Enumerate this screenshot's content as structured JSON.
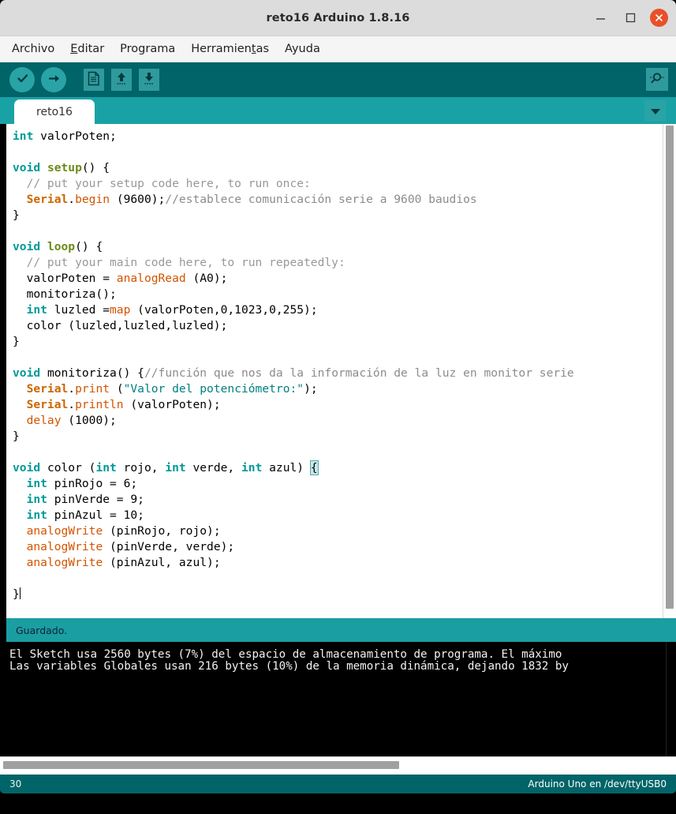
{
  "window": {
    "title": "reto16 Arduino 1.8.16",
    "minimize_label": "minimize-icon",
    "maximize_label": "maximize-icon",
    "close_label": "close-icon"
  },
  "menu": {
    "items": [
      {
        "label": "Archivo",
        "mnemonic": ""
      },
      {
        "label": "Editar",
        "mnemonic": "E"
      },
      {
        "label": "Programa",
        "mnemonic": ""
      },
      {
        "label": "Herramientas",
        "mnemonic": "t"
      },
      {
        "label": "Ayuda",
        "mnemonic": ""
      }
    ]
  },
  "toolbar": {
    "buttons": [
      {
        "name": "verify-button",
        "icon": "check-icon",
        "tooltip": "Verificar"
      },
      {
        "name": "upload-button",
        "icon": "arrow-right-icon",
        "tooltip": "Subir"
      },
      {
        "name": "new-button",
        "icon": "new-file-icon",
        "tooltip": "Nuevo"
      },
      {
        "name": "open-button",
        "icon": "arrow-up-icon",
        "tooltip": "Abrir"
      },
      {
        "name": "save-button",
        "icon": "arrow-down-icon",
        "tooltip": "Guardar"
      }
    ],
    "serial_monitor": {
      "name": "serial-monitor-button",
      "icon": "magnifier-icon"
    }
  },
  "tabs": {
    "active": "reto16",
    "items": [
      "reto16"
    ],
    "menu_icon": "chevron-down-icon"
  },
  "editor": {
    "lines": [
      "int valorPoten;",
      "",
      "void setup() {",
      "  // put your setup code here, to run once:",
      "  Serial.begin (9600);//establece comunicación serie a 9600 baudios",
      "}",
      "",
      "void loop() {",
      "  // put your main code here, to run repeatedly:",
      "  valorPoten = analogRead (A0);",
      "  monitoriza();",
      "  int luzled =map (valorPoten,0,1023,0,255);",
      "  color (luzled,luzled,luzled);",
      "}",
      "",
      "void monitoriza() {//función que nos da la información de la luz en monitor serie",
      "  Serial.print (\"Valor del potenciómetro:\");",
      "  Serial.println (valorPoten);",
      "  delay (1000);",
      "}",
      "",
      "void color (int rojo, int verde, int azul) {",
      "  int pinRojo = 6;",
      "  int pinVerde = 9;",
      "  int pinAzul = 10;",
      "  analogWrite (pinRojo, rojo);",
      "  analogWrite (pinVerde, verde);",
      "  analogWrite (pinAzul, azul);",
      "",
      "}"
    ]
  },
  "status": {
    "message": "Guardado."
  },
  "console": {
    "lines": [
      "El Sketch usa 2560 bytes (7%) del espacio de almacenamiento de programa. El máximo ",
      "Las variables Globales usan 216 bytes (10%) de la memoria dinámica, dejando 1832 by"
    ]
  },
  "bottombar": {
    "line_number": "30",
    "board": "Arduino Uno en /dev/ttyUSB0"
  },
  "colors": {
    "toolbar_bg": "#006468",
    "tabbar_bg": "#18a2a6",
    "status_bg": "#1a9ea2",
    "close_btn": "#e8502a",
    "keyword": "#009999",
    "function": "#d35400",
    "comment": "#999999",
    "string": "#007f7f",
    "library": "#cc6600",
    "funcname": "#6b8a1a"
  }
}
